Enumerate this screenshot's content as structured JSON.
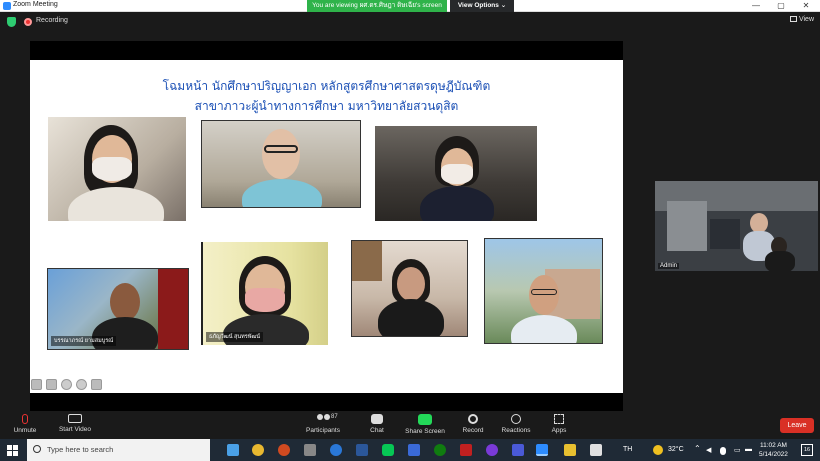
{
  "window": {
    "title": "Zoom Meeting",
    "viewing_banner": "You are viewing ผศ.ดร.ศิษฎา ดิษเฉีย's screen",
    "view_options": "View Options ⌄",
    "controls": [
      "—",
      "▢",
      "✕"
    ]
  },
  "meeting_bar": {
    "recording_label": "Recording",
    "view_label": "View"
  },
  "slide": {
    "title_line1": "โฉมหน้า นักศึกษาปริญญาเอก หลักสูตรศึกษาศาสตรดุษฎีบัณฑิต",
    "title_line2": "สาขาภาวะผู้นำทางการศึกษา มหาวิทยาลัยสวนดุสิต",
    "participants": [
      {
        "name": ""
      },
      {
        "name": ""
      },
      {
        "name": ""
      },
      {
        "name": "บรรณาภรณ์ ยามสมบูรณ์"
      },
      {
        "name": "ธภัญวัฒน์ สุนทรพัฒน์"
      },
      {
        "name": ""
      },
      {
        "name": ""
      }
    ]
  },
  "side_video": {
    "name": "Admin"
  },
  "toolbar": {
    "unmute": "Unmute",
    "start_video": "Start Video",
    "participants": "Participants",
    "participants_count": "87",
    "chat": "Chat",
    "share_screen": "Share Screen",
    "record": "Record",
    "reactions": "Reactions",
    "apps": "Apps",
    "leave": "Leave"
  },
  "taskbar": {
    "search_placeholder": "Type here to search",
    "language": "TH",
    "temperature": "32°C",
    "time": "11:02 AM",
    "date": "5/14/2022",
    "notification_count": "16"
  },
  "colors": {
    "viewing_green": "#2fb34a",
    "leave_red": "#d93025",
    "slide_title_blue": "#1a4fb5",
    "share_green": "#23d959"
  }
}
